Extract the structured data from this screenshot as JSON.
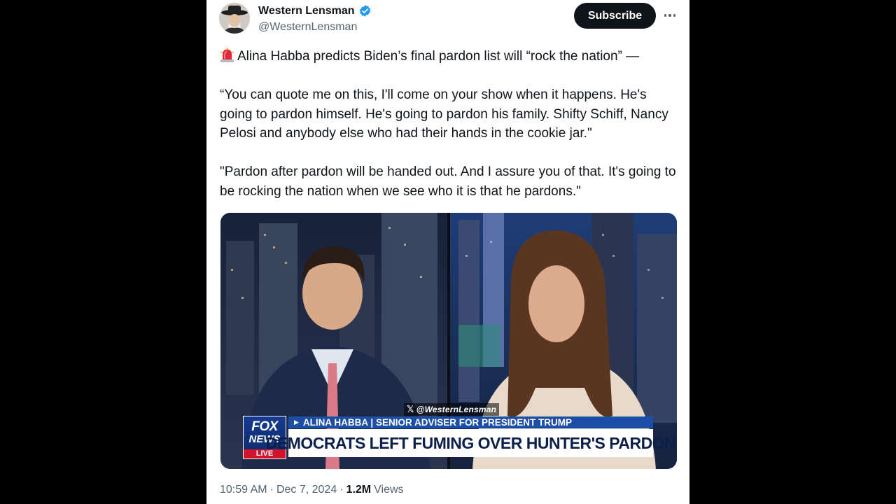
{
  "author": {
    "display_name": "Western Lensman",
    "handle": "@WesternLensman",
    "verified": true,
    "avatar_icon": "avatar-cowboy-hat"
  },
  "actions": {
    "subscribe_label": "Subscribe",
    "more_icon": "more-horizontal-icon"
  },
  "tweet": {
    "lead_icon": "police-siren-emoji",
    "paragraphs": [
      "Alina Habba predicts Biden’s final pardon list will “rock the nation” —",
      "“You can quote me on this, I'll come on your show when it happens. He's going to pardon himself. He's going to pardon his family. Shifty Schiff, Nancy Pelosi and anybody else who had their hands in the cookie jar.\"",
      "\"Pardon after pardon will be handed out. And I assure you of that. It's going to be rocking the nation when we see who it is that he pardons.\""
    ]
  },
  "media": {
    "watermark": "@WesternLensman",
    "network_logo": [
      "FOX",
      "NEWS",
      "LIVE"
    ],
    "lower_third_top": "ALINA HABBA | SENIOR ADVISER FOR PRESIDENT TRUMP",
    "lower_third_main": "DEMOCRATS LEFT FUMING OVER HUNTER'S PARDON"
  },
  "meta": {
    "time": "10:59 AM",
    "separator": "·",
    "date": "Dec 7, 2024",
    "views_count": "1.2M",
    "views_label": "Views"
  },
  "colors": {
    "text_primary": "#0f1419",
    "text_secondary": "#536471",
    "verified_blue": "#1d9bf0",
    "fox_blue": "#1c4ea6",
    "fox_red": "#d0142c"
  }
}
